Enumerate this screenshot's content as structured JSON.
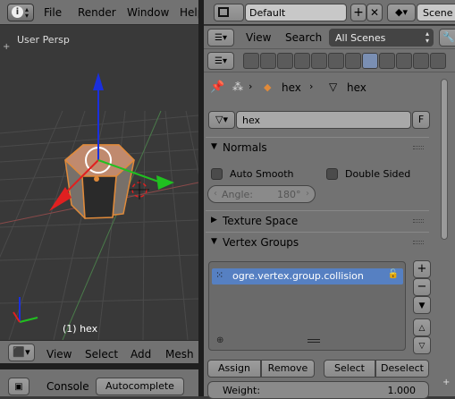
{
  "top_menu": {
    "items": [
      "File",
      "Render",
      "Window",
      "Help"
    ],
    "layout": "Default",
    "scene": "Scene"
  },
  "viewport": {
    "view_label": "User Persp",
    "object_label": "(1) hex",
    "header": {
      "items": [
        "View",
        "Select",
        "Add",
        "Mesh"
      ]
    }
  },
  "console": {
    "tab": "Console",
    "button": "Autocomplete"
  },
  "properties": {
    "header": {
      "view": "View",
      "search": "Search",
      "scope": "All Scenes"
    },
    "breadcrumb": {
      "object": "hex",
      "mesh": "hex"
    },
    "datablock": {
      "name": "hex",
      "fake_user": "F"
    },
    "normals": {
      "title": "Normals",
      "auto_smooth": "Auto Smooth",
      "double_sided": "Double Sided",
      "angle_label": "Angle:",
      "angle_value": "180°"
    },
    "texture_space": {
      "title": "Texture Space"
    },
    "vertex_groups": {
      "title": "Vertex Groups",
      "items": [
        "ogre.vertex.group.collision"
      ],
      "buttons": {
        "assign": "Assign",
        "remove": "Remove",
        "select": "Select",
        "deselect": "Deselect"
      },
      "weight_label": "Weight:",
      "weight_value": "1.000"
    }
  },
  "colors": {
    "selection": "#5680c2",
    "mesh_orange": "#e08a3a",
    "axis_red": "#e02020",
    "axis_green": "#20c020",
    "axis_blue": "#1a2fdd"
  }
}
